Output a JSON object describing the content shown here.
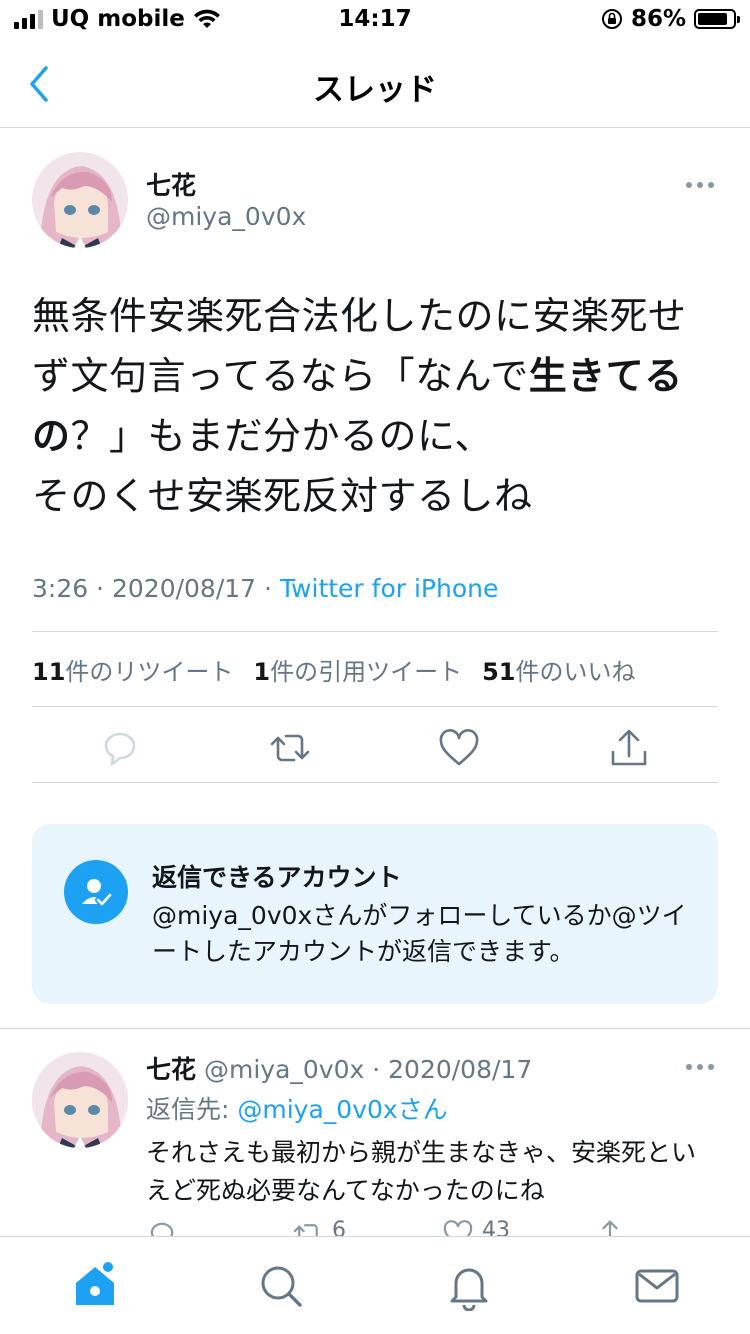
{
  "status_bar": {
    "carrier": "UQ mobile",
    "time": "14:17",
    "battery_percent": "86%",
    "battery_level": 0.86
  },
  "nav": {
    "title": "スレッド",
    "back_icon": "chevron-left-icon"
  },
  "main_tweet": {
    "display_name": "七花",
    "handle": "@miya_0v0x",
    "text_line1": "無条件安楽死合法化したのに安楽死せ",
    "text_line2_pre": "ず文句言ってるなら「なんで",
    "text_line2_bold": "生きてる",
    "text_line3_bold": "の",
    "text_line3_post": "？」もまだ分かるのに、",
    "text_line4": "そのくせ安楽死反対するしね",
    "time": "3:26",
    "date": "2020/08/17",
    "source": "Twitter for iPhone",
    "retweets_count": "11",
    "retweets_label": "件のリツイート",
    "quotes_count": "1",
    "quotes_label": "件の引用ツイート",
    "likes_count": "51",
    "likes_label": "件のいいね"
  },
  "reply_restriction": {
    "title": "返信できるアカウント",
    "description": "@miya_0v0xさんがフォローしているか@ツイートしたアカウントが返信できます。",
    "icon": "user-check-icon"
  },
  "reply_tweet": {
    "display_name": "七花",
    "handle": "@miya_0v0x",
    "date": "2020/08/17",
    "reply_to_label": "返信先: ",
    "reply_to_user": "@miya_0v0xさん",
    "text": "それさえも最初から親が生まなきゃ、安楽死といえど死ぬ必要なんてなかったのにね",
    "retweets": "6",
    "likes": "43"
  },
  "tab_bar": {
    "items": [
      "home-icon",
      "search-icon",
      "notifications-icon",
      "messages-icon"
    ]
  },
  "colors": {
    "accent": "#1da1f2",
    "secondary_text": "#657786",
    "card_bg": "#e8f5fd"
  }
}
